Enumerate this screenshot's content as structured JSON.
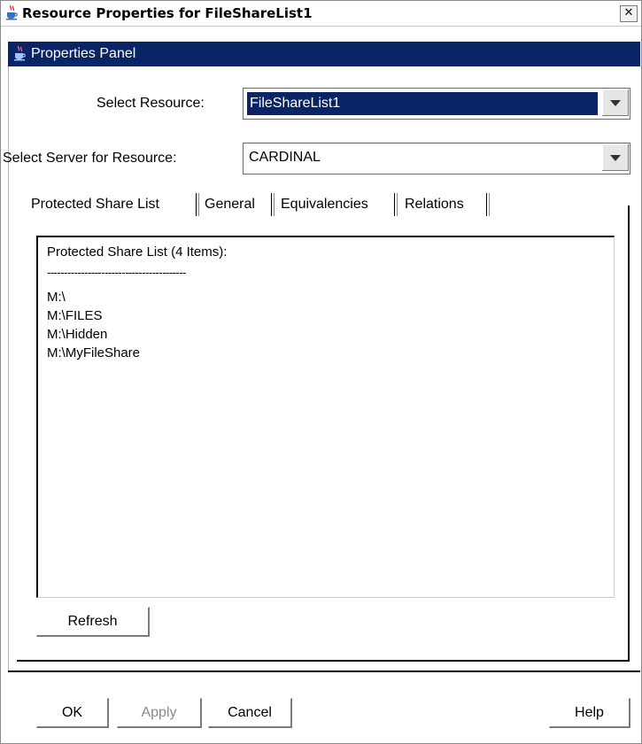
{
  "window": {
    "title": "Resource Properties for FileShareList1",
    "close_glyph": "✕"
  },
  "panel": {
    "title": "Properties Panel"
  },
  "form": {
    "resource_label": "Select Resource:",
    "resource_value": "FileShareList1",
    "server_label": "Select Server for Resource:",
    "server_value": "CARDINAL"
  },
  "tabs": [
    {
      "label": "Protected Share List",
      "active": true
    },
    {
      "label": "General",
      "active": false
    },
    {
      "label": "Equivalencies",
      "active": false
    },
    {
      "label": "Relations",
      "active": false
    }
  ],
  "share_list": {
    "header": "Protected Share List (4 Items):",
    "divider": "-----------------------------------------",
    "items": [
      "M:\\",
      "M:\\FILES",
      "M:\\Hidden",
      "M:\\MyFileShare"
    ]
  },
  "buttons": {
    "refresh": "Refresh",
    "ok": "OK",
    "apply": "Apply",
    "cancel": "Cancel",
    "help": "Help"
  },
  "icons": {
    "window": "java-cup-icon",
    "panel": "java-cup-icon",
    "dropdown": "chevron-down-icon"
  },
  "colors": {
    "selection": "#0a2565",
    "panel_header": "#0a2565"
  }
}
